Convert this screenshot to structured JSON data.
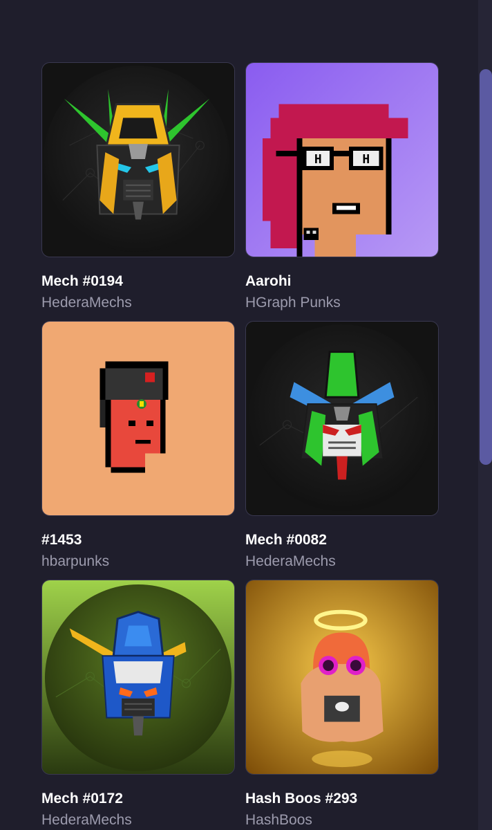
{
  "items": [
    {
      "name": "Mech #0194",
      "collection": "HederaMechs",
      "art_icon": "mech-head-icon",
      "bg": "#111111"
    },
    {
      "name": "Aarohi",
      "collection": "HGraph Punks",
      "art_icon": "pixel-punk-icon",
      "bg": "#9a70ea"
    },
    {
      "name": "#1453",
      "collection": "hbarpunks",
      "art_icon": "pixel-punk-icon",
      "bg": "#f0a872"
    },
    {
      "name": "Mech #0082",
      "collection": "HederaMechs",
      "art_icon": "mech-head-icon",
      "bg": "#111111"
    },
    {
      "name": "Mech #0172",
      "collection": "HederaMechs",
      "art_icon": "mech-head-icon",
      "bg": "#6e9d2a"
    },
    {
      "name": "Hash Boos #293",
      "collection": "HashBoos",
      "art_icon": "ghost-icon",
      "bg": "#e6a20f"
    }
  ],
  "pixel_text": "H"
}
